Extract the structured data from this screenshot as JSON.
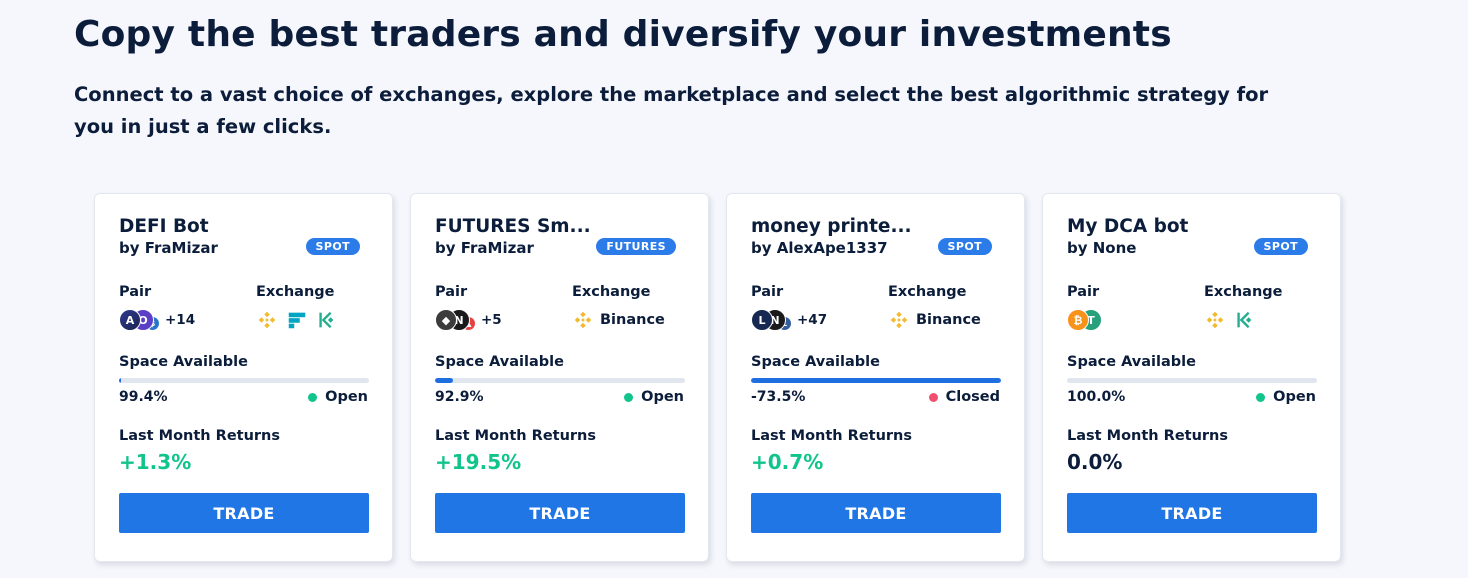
{
  "hero": {
    "title": "Copy the best traders and diversify your investments",
    "subtitle": "Connect to a vast choice of exchanges, explore the marketplace and select the best algorithmic strategy for you in just a few clicks."
  },
  "labels": {
    "pair": "Pair",
    "exchange": "Exchange",
    "space_available": "Space Available",
    "last_month_returns": "Last Month Returns",
    "trade": "TRADE"
  },
  "colors": {
    "accent": "#2176e6",
    "positive": "#10c48b",
    "neutral": "#0b1d3a",
    "open_dot": "#10c48b",
    "closed_dot": "#f0506e"
  },
  "bots": [
    {
      "name": "DEFI Bot",
      "author": "by FraMizar",
      "type": "SPOT",
      "pair_icons": [
        "aave-icon",
        "ocean-icon",
        "usdc-icon"
      ],
      "pair_more": "+14",
      "exchanges": [
        "binance-icon",
        "ftx-icon",
        "kucoin-icon"
      ],
      "exchange_name": "",
      "space_value": "99.4%",
      "space_fill": 0.006,
      "status": "Open",
      "status_color": "#10c48b",
      "returns": "+1.3%",
      "returns_color": "#10c48b"
    },
    {
      "name": "FUTURES Sm...",
      "author": "by FraMizar",
      "type": "FUTURES",
      "pair_icons": [
        "ethereum-icon",
        "near-icon",
        "avalanche-icon"
      ],
      "pair_more": "+5",
      "exchanges": [
        "binance-icon"
      ],
      "exchange_name": "Binance",
      "space_value": "92.9%",
      "space_fill": 0.071,
      "status": "Open",
      "status_color": "#10c48b",
      "returns": "+19.5%",
      "returns_color": "#10c48b"
    },
    {
      "name": "money printe...",
      "author": "by AlexApe1337",
      "type": "SPOT",
      "pair_icons": [
        "luna-icon",
        "near-icon",
        "litecoin-icon"
      ],
      "pair_more": "+47",
      "exchanges": [
        "binance-icon"
      ],
      "exchange_name": "Binance",
      "space_value": "-73.5%",
      "space_fill": 1.0,
      "status": "Closed",
      "status_color": "#f0506e",
      "returns": "+0.7%",
      "returns_color": "#10c48b"
    },
    {
      "name": "My DCA bot",
      "author": "by None",
      "type": "SPOT",
      "pair_icons": [
        "bitcoin-icon",
        "tether-icon"
      ],
      "pair_more": "",
      "exchanges": [
        "binance-icon",
        "kucoin-icon"
      ],
      "exchange_name": "",
      "space_value": "100.0%",
      "space_fill": 0.0,
      "status": "Open",
      "status_color": "#10c48b",
      "returns": "0.0%",
      "returns_color": "#0b1d3a"
    }
  ]
}
